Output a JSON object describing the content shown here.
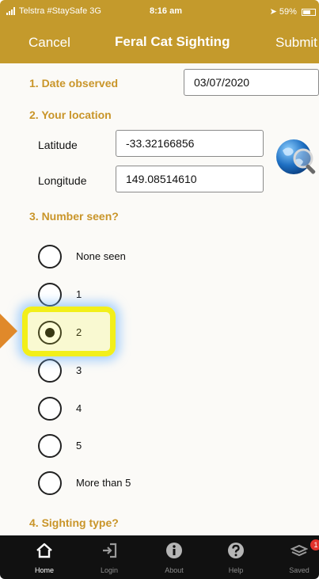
{
  "status_bar": {
    "carrier": "Telstra #StaySafe  3G",
    "time": "8:16 am",
    "battery": "59%"
  },
  "nav": {
    "left_label": "Cancel",
    "title": "Feral Cat Sighting",
    "right_label": "Submit"
  },
  "form": {
    "date_label": "1. Date observed",
    "date_value": "03/07/2020",
    "location_label": "2. Your location",
    "latitude_label": "Latitude",
    "latitude_value": "-33.32166856",
    "longitude_label": "Longitude",
    "longitude_value": "149.08514610",
    "number_label": "3. Number seen?",
    "number_options": [
      {
        "label": "None seen",
        "selected": false
      },
      {
        "label": "1",
        "selected": false
      },
      {
        "label": "2",
        "selected": true
      },
      {
        "label": "3",
        "selected": false
      },
      {
        "label": "4",
        "selected": false
      },
      {
        "label": "5",
        "selected": false
      },
      {
        "label": "More than 5",
        "selected": false
      }
    ],
    "sighting_label": "4. Sighting type?"
  },
  "tabs": [
    {
      "label": "Home",
      "icon": "home-icon",
      "active": true
    },
    {
      "label": "Login",
      "icon": "login-icon",
      "active": false
    },
    {
      "label": "About",
      "icon": "info-icon",
      "active": false
    },
    {
      "label": "Help",
      "icon": "help-icon",
      "active": false
    },
    {
      "label": "Saved",
      "icon": "saved-icon",
      "active": false
    }
  ],
  "saved_badge": "1",
  "colors": {
    "brand": "#c49a2c",
    "section": "#c99529",
    "tabbar": "#111111",
    "highlight": "#f2ef1a",
    "arrow": "#e0892a"
  }
}
